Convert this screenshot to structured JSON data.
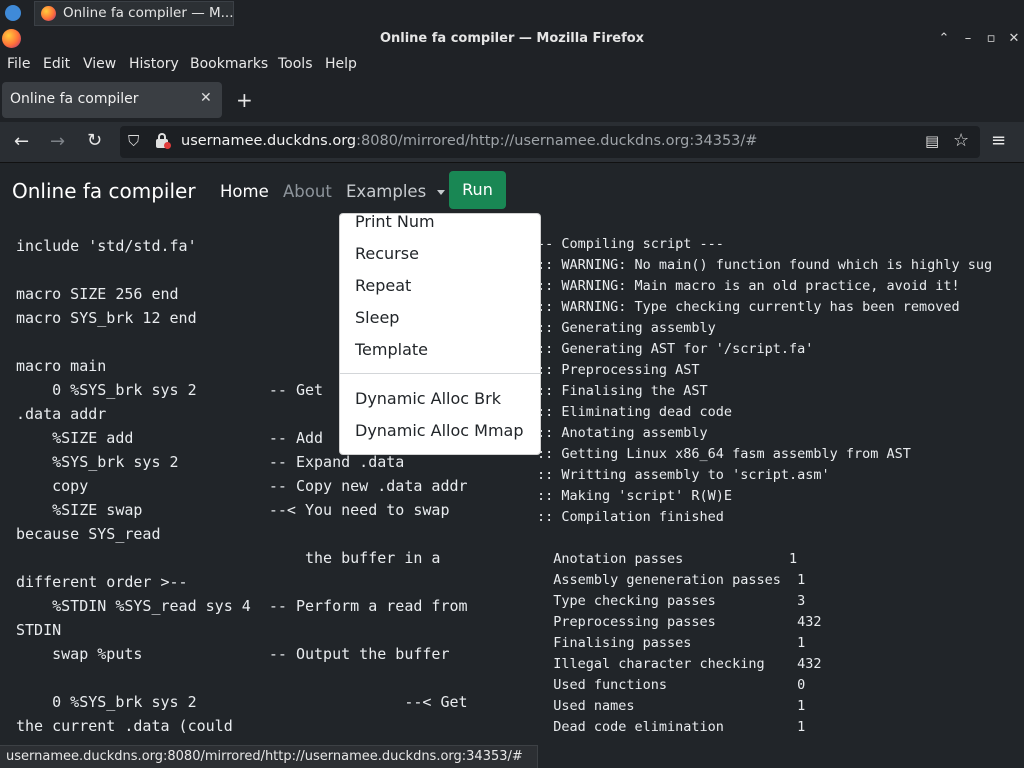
{
  "taskbar": {
    "window_button": "Online fa compiler — M..."
  },
  "window": {
    "title": "Online fa compiler — Mozilla Firefox"
  },
  "menu": [
    "File",
    "Edit",
    "View",
    "History",
    "Bookmarks",
    "Tools",
    "Help"
  ],
  "tab": {
    "title": "Online fa compiler"
  },
  "url": {
    "domain": "usernamee.duckdns.org",
    "rest": ":8080/mirrored/http://usernamee.duckdns.org:34353/#"
  },
  "nav": {
    "brand": "Online fa compiler",
    "home": "Home",
    "about": "About",
    "examples": "Examples",
    "run": "Run"
  },
  "dropdown": {
    "items": [
      "Print Num",
      "Recurse",
      "Repeat",
      "Sleep",
      "Template"
    ],
    "items2": [
      "Dynamic Alloc Brk",
      "Dynamic Alloc Mmap"
    ]
  },
  "code_lines": [
    "include 'std/std.fa'",
    "",
    "macro SIZE 256 end",
    "macro SYS_brk 12 end",
    "",
    "macro main",
    "    0 %SYS_brk sys 2        -- Get",
    ".data addr",
    "    %SIZE add               -- Add",
    "    %SYS_brk sys 2          -- Expand .data",
    "    copy                    -- Copy new .data addr",
    "    %SIZE swap              --< You need to swap",
    "because SYS_read",
    "                                the buffer in a",
    "different order >--",
    "    %STDIN %SYS_read sys 4  -- Perform a read from",
    "STDIN",
    "    swap %puts              -- Output the buffer",
    "",
    "    0 %SYS_brk sys 2                       --< Get",
    "the current .data (could"
  ],
  "output_lines": [
    "-- Compiling script ---",
    ":: WARNING: No main() function found which is highly sug",
    ":: WARNING: Main macro is an old practice, avoid it!",
    ":: WARNING: Type checking currently has been removed",
    ":: Generating assembly",
    ":: Generating AST for '/script.fa'",
    ":: Preprocessing AST",
    ":: Finalising the AST",
    ":: Eliminating dead code",
    ":: Anotating assembly",
    ":: Getting Linux x86_64 fasm assembly from AST",
    ":: Writting assembly to 'script.asm'",
    ":: Making 'script' R(W)E",
    ":: Compilation finished",
    "",
    "  Anotation passes             1",
    "  Assembly geneneration passes  1",
    "  Type checking passes          3",
    "  Preprocessing passes          432",
    "  Finalising passes             1",
    "  Illegal character checking    432",
    "  Used functions                0",
    "  Used names                    1",
    "  Dead code elimination         1"
  ],
  "status": {
    "url": "usernamee.duckdns.org:8080/mirrored/http://usernamee.duckdns.org:34353/#"
  },
  "colors": {
    "page_bg": "#212529",
    "run_button": "#198754",
    "dropdown_bg": "#ffffff",
    "muted_link": "#8d949b"
  },
  "icons": [
    "app-icon",
    "firefox-icon",
    "chevron-up-icon",
    "minimize-icon",
    "maximize-icon",
    "close-icon",
    "new-tab-icon",
    "back-icon",
    "forward-icon",
    "reload-icon",
    "shield-icon",
    "lock-icon",
    "reader-icon",
    "bookmark-star-icon",
    "hamburger-menu-icon"
  ]
}
